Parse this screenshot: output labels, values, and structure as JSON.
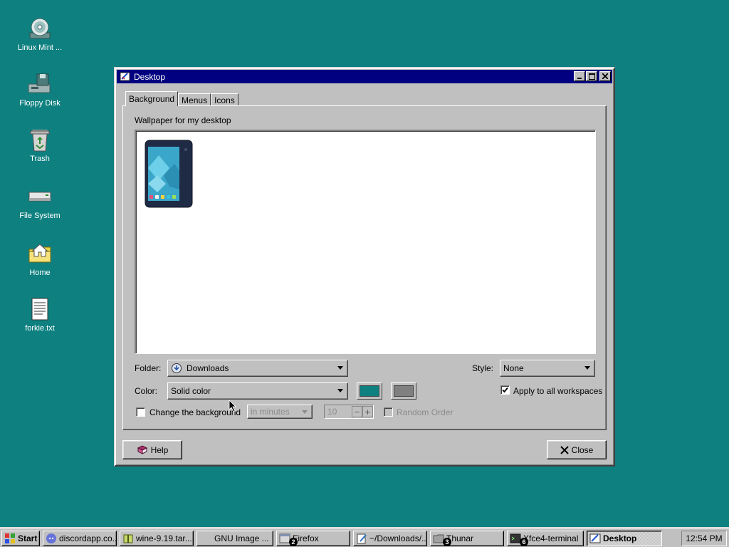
{
  "desktop": {
    "icons": [
      {
        "label": "Linux Mint ...",
        "icon": "cd-icon"
      },
      {
        "label": "Floppy Disk",
        "icon": "floppy-disk-icon"
      },
      {
        "label": "Trash",
        "icon": "trash-icon"
      },
      {
        "label": "File System",
        "icon": "drive-icon"
      },
      {
        "label": "Home",
        "icon": "home-folder-icon"
      },
      {
        "label": "forkie.txt",
        "icon": "text-file-icon"
      }
    ]
  },
  "window": {
    "title": "Desktop",
    "tabs": [
      {
        "label": "Background",
        "active": true
      },
      {
        "label": "Menus",
        "active": false
      },
      {
        "label": "Icons",
        "active": false
      }
    ],
    "wallpaper_label": "Wallpaper for my desktop",
    "folder": {
      "label": "Folder:",
      "value": "Downloads"
    },
    "style": {
      "label": "Style:",
      "value": "None"
    },
    "color": {
      "label": "Color:",
      "value": "Solid color",
      "primary": "#0f8080",
      "secondary": "#808080"
    },
    "apply_all": {
      "label": "Apply to all workspaces",
      "checked": true
    },
    "change_bg": {
      "label": "Change the background",
      "checked": false
    },
    "interval": {
      "value": "in minutes",
      "enabled": false
    },
    "spin": {
      "value": "10",
      "minus": "−",
      "plus": "+"
    },
    "random": {
      "label": "Random Order",
      "enabled": false
    },
    "help_label": "Help",
    "close_label": "Close"
  },
  "taskbar": {
    "start_label": "Start",
    "items": [
      {
        "label": "discordapp.co...",
        "icon": "discord-icon",
        "active": false
      },
      {
        "label": "wine-9.19.tar....",
        "icon": "archive-icon",
        "active": false
      },
      {
        "label": "GNU Image ...",
        "icon": "",
        "active": false
      },
      {
        "label": "Firefox",
        "icon": "firefox-icon",
        "badge": "2",
        "active": false
      },
      {
        "label": "~/Downloads/...",
        "icon": "editor-icon",
        "active": false
      },
      {
        "label": "Thunar",
        "icon": "folder-icon",
        "badge": "3",
        "active": false
      },
      {
        "label": "Xfce4-terminal",
        "icon": "terminal-icon",
        "badge": "6",
        "active": false
      },
      {
        "label": "Desktop",
        "icon": "desktop-settings-icon",
        "active": true
      }
    ],
    "clock": "12:54 PM"
  },
  "colors": {
    "desktop_bg": "#0f8080",
    "titlebar": "#000080",
    "face": "#c0c0c0"
  }
}
